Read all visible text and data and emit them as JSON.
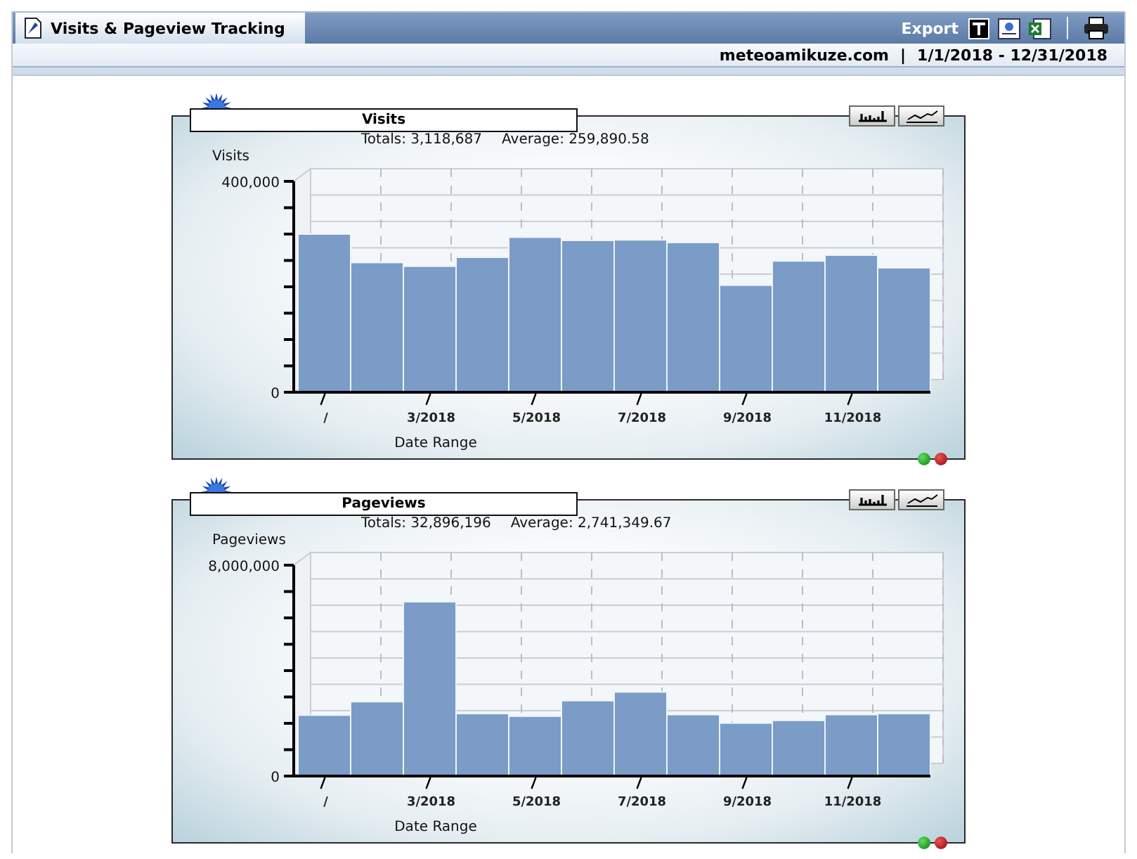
{
  "header": {
    "tab": {
      "label": "Visits & Pageview Tracking",
      "selected": true
    },
    "export_label": "Export",
    "site": "meteoamikuze.com",
    "separator": "|",
    "date_range": "1/1/2018 - 12/31/2018"
  },
  "panels": [
    {
      "title": "Visits",
      "totals": "Totals: 3,118,687",
      "average": "Average: 259,890.58",
      "chart_data": {
        "type": "bar",
        "ylabel": "Visits",
        "xlabel": "Date Range",
        "categories": [
          "/",
          null,
          "3/2018",
          null,
          "5/2018",
          null,
          "7/2018",
          null,
          "9/2018",
          null,
          "11/2018",
          null
        ],
        "grid": true,
        "ylim": [
          0,
          400000
        ],
        "yticks": [
          {
            "value": 0,
            "label": "0"
          },
          {
            "value": 400000,
            "label": "400,000"
          }
        ],
        "series": [
          {
            "color": "#7a9cc6",
            "values": [
              300000,
              246000,
              239000,
              256000,
              294000,
              288000,
              289000,
              284000,
              203000,
              249000,
              260000,
              236000
            ]
          }
        ]
      }
    },
    {
      "title": "Pageviews",
      "totals": "Totals: 32,896,196",
      "average": "Average: 2,741,349.67",
      "chart_data": {
        "type": "bar",
        "ylabel": "Pageviews",
        "xlabel": "Date Range",
        "categories": [
          "/",
          null,
          "3/2018",
          null,
          "5/2018",
          null,
          "7/2018",
          null,
          "9/2018",
          null,
          "11/2018",
          null
        ],
        "grid": true,
        "ylim": [
          0,
          8000000
        ],
        "yticks": [
          {
            "value": 0,
            "label": "0"
          },
          {
            "value": 8000000,
            "label": "8,000,000"
          }
        ],
        "series": [
          {
            "color": "#7a9cc6",
            "values": [
              2310000,
              2820000,
              6610000,
              2370000,
              2270000,
              2860000,
              3190000,
              2330000,
              2010000,
              2110000,
              2330000,
              2370000
            ]
          }
        ]
      }
    }
  ]
}
